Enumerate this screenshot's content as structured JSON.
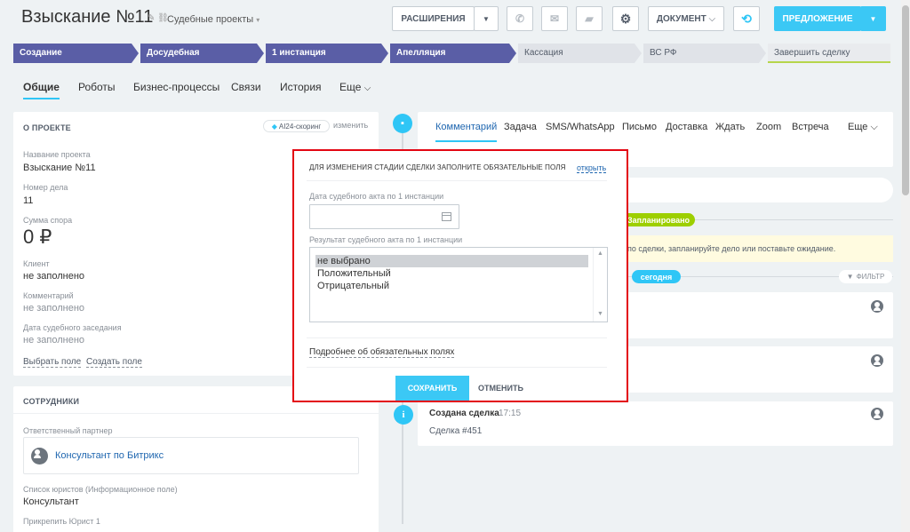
{
  "header": {
    "title": "Взыскание №11",
    "category": "Судебные проекты",
    "buttons": {
      "extensions": "РАСШИРЕНИЯ",
      "document": "ДОКУМЕНТ",
      "offer": "ПРЕДЛОЖЕНИЕ"
    }
  },
  "stages": [
    "Создание",
    "Досудебная",
    "1 инстанция",
    "Апелляция",
    "Кассация",
    "ВС РФ",
    "Завершить сделку"
  ],
  "tabs": [
    "Общие",
    "Роботы",
    "Бизнес-процессы",
    "Связи",
    "История",
    "Еще"
  ],
  "about": {
    "header": "О ПРОЕКТЕ",
    "badge": "AI24-скоринг",
    "edit": "изменить",
    "fields": [
      {
        "label": "Название проекта",
        "value": "Взыскание №11"
      },
      {
        "label": "Номер дела",
        "value": "11"
      },
      {
        "label": "Сумма спора",
        "value": "0 ₽"
      },
      {
        "label": "Клиент",
        "value": "не заполнено"
      },
      {
        "label": "Комментарий",
        "value": "не заполнено"
      },
      {
        "label": "Дата судебного заседания",
        "value": "не заполнено"
      }
    ],
    "choose_field": "Выбрать поле",
    "create_field": "Создать поле"
  },
  "staff": {
    "header": "СОТРУДНИКИ",
    "partner_label": "Ответственный партнер",
    "partner_name": "Консультант по Битрикс",
    "lawyers_label": "Список юристов (Информационное поле)",
    "lawyers_value": "Консультант",
    "attach_label": "Прикрепить Юрист 1"
  },
  "activity": {
    "tabs": [
      "Комментарий",
      "Задача",
      "SMS/WhatsApp",
      "Письмо",
      "Доставка",
      "Ждать",
      "Zoom",
      "Встреча",
      "Еще"
    ],
    "planned": "Запланировано",
    "planned_hint": "по сделки, запланируйте дело или поставьте ожидание.",
    "today": "сегодня",
    "filter": "ФИЛЬТР",
    "created_title": "Создана сделка",
    "created_time": "17:15",
    "created_sub": "Сделка #451"
  },
  "modal": {
    "header": "ДЛЯ ИЗМЕНЕНИЯ СТАДИИ СДЕЛКИ ЗАПОЛНИТЕ ОБЯЗАТЕЛЬНЫЕ ПОЛЯ",
    "open": "открыть",
    "date_label": "Дата судебного акта по 1 инстанции",
    "result_label": "Результат судебного акта по 1 инстанции",
    "options": [
      "не выбрано",
      "Положительный",
      "Отрицательный"
    ],
    "more_link": "Подробнее об обязательных полях",
    "save": "СОХРАНИТЬ",
    "cancel": "ОТМЕНИТЬ"
  },
  "colors": {
    "accent": "#3bc8f5",
    "stage_done": "#5a5ea6",
    "planned": "#9dcf00",
    "highlight": "#e30613"
  }
}
